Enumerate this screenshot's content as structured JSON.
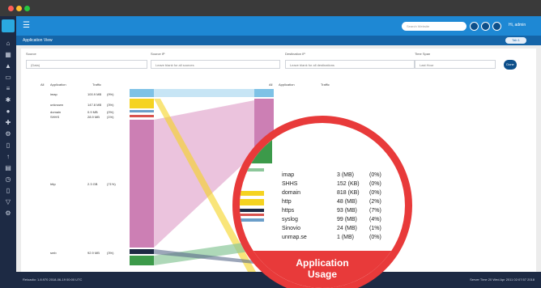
{
  "window": {
    "title": "Application View"
  },
  "topbar": {
    "search_placeholder": "Search Website",
    "user": "Hi, admin"
  },
  "subbar": {
    "title": "Application View",
    "pill": "Tab 1"
  },
  "filters": {
    "source_label": "Source",
    "source_value": "(Data)",
    "source_ip_label": "Source IP",
    "source_ip_placeholder": "Leave blank for all sources",
    "dest_ip_label": "Destination IP",
    "dest_ip_placeholder": "Leave blank for all destinations",
    "time_label": "Time Span",
    "time_value": "Last Hour",
    "button": "Done"
  },
  "columns": {
    "left_all": "All",
    "left_app": "Application",
    "left_traffic": "Traffic",
    "right_all": "All",
    "right_app": "Application",
    "right_traffic": "Traffic"
  },
  "apps_left": [
    {
      "name": "imap",
      "value": "100.9 MB",
      "pct": "(9%)"
    },
    {
      "name": "unknown",
      "value": "147.8 MB",
      "pct": "(3%)"
    },
    {
      "name": "domain",
      "value": "0.9 MB",
      "pct": "(0%)"
    },
    {
      "name": "SHHS",
      "value": "28.9 MB",
      "pct": "(1%)"
    },
    {
      "name": "http",
      "value": "2.3 GB",
      "pct": "(71%)"
    },
    {
      "name": "smb",
      "value": "92.9 MB",
      "pct": "(3%)"
    }
  ],
  "magnifier": {
    "rows": [
      {
        "name": "imap",
        "value": "3 (MB)",
        "pct": "(0%)"
      },
      {
        "name": "SHHS",
        "value": "152 (KB)",
        "pct": "(0%)"
      },
      {
        "name": "domain",
        "value": "818 (KB)",
        "pct": "(0%)"
      },
      {
        "name": "http",
        "value": "48 (MB)",
        "pct": "(2%)"
      },
      {
        "name": "https",
        "value": "93 (MB)",
        "pct": "(7%)"
      },
      {
        "name": "syslog",
        "value": "99 (MB)",
        "pct": "(4%)"
      },
      {
        "name": "Sinovio",
        "value": "24 (MB)",
        "pct": "(1%)"
      },
      {
        "name": "unmap.se",
        "value": "1 (MB)",
        "pct": "(0%)"
      }
    ],
    "badge_line1": "Application",
    "badge_line2": "Usage"
  },
  "status": {
    "left": "Reloadio: 1.8.970 2018-06-19 00:00 UTC",
    "right": "Server Time 20 Wed Apr 2011 02:07:57 2018"
  },
  "colors": {
    "accent": "#1e88d4",
    "sidebar": "#1d2a44",
    "magnifier_ring": "#e83a3a"
  }
}
